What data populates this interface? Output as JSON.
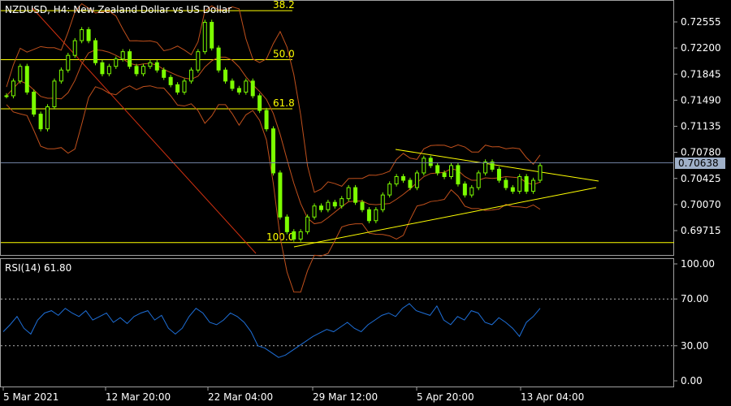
{
  "header": {
    "main_title": "NZDUSD, H4:  New Zealand Dollar vs US Dollar",
    "rsi_title": "RSI(14) 61.80"
  },
  "colors": {
    "background": "#000000",
    "candles": "#7cfc00",
    "bollinger": "#c0501c",
    "fib_lines": "#ffff00",
    "trendlines": "#ffff00",
    "rsi_line": "#1e6fd8",
    "current_price_line": "#6f7f9f",
    "current_price_box": "#9fb0c8"
  },
  "price_axis": {
    "ticks": [
      "0.72555",
      "0.72200",
      "0.71845",
      "0.71490",
      "0.71135",
      "0.70780",
      "0.70425",
      "0.70070",
      "0.69715"
    ],
    "current_price": "0.70638"
  },
  "fib_levels": [
    {
      "label": "38.2",
      "price": 0.72708
    },
    {
      "label": "50.0",
      "price": 0.72041
    },
    {
      "label": "61.8",
      "price": 0.71373
    },
    {
      "label": "100.0",
      "price": 0.69552
    }
  ],
  "rsi_axis": {
    "ticks": [
      "100.00",
      "70.00",
      "30.00",
      "0.00"
    ],
    "levels": [
      70,
      30
    ],
    "current": 61.8
  },
  "time_axis": {
    "labels": [
      "5 Mar 2021",
      "12 Mar 20:00",
      "22 Mar 04:00",
      "29 Mar 12:00",
      "5 Apr 20:00",
      "13 Apr 04:00"
    ]
  },
  "chart_data": {
    "type": "line",
    "title": "NZDUSD, H4:  New Zealand Dollar vs US Dollar",
    "series": [
      {
        "name": "NZDUSD",
        "values": [
          0.7155,
          0.7175,
          0.7195,
          0.716,
          0.713,
          0.711,
          0.714,
          0.7175,
          0.719,
          0.721,
          0.723,
          0.7245,
          0.723,
          0.72,
          0.7185,
          0.7195,
          0.7205,
          0.7215,
          0.7195,
          0.7185,
          0.7195,
          0.72,
          0.719,
          0.718,
          0.717,
          0.716,
          0.7175,
          0.719,
          0.7215,
          0.7255,
          0.722,
          0.719,
          0.7175,
          0.7165,
          0.716,
          0.7175,
          0.7155,
          0.7135,
          0.711,
          0.705,
          0.699,
          0.697,
          0.696,
          0.697,
          0.699,
          0.7005,
          0.7,
          0.701,
          0.7005,
          0.7015,
          0.703,
          0.701,
          0.7,
          0.6985,
          0.7,
          0.702,
          0.7035,
          0.7045,
          0.704,
          0.703,
          0.705,
          0.707,
          0.706,
          0.705,
          0.7045,
          0.706,
          0.7035,
          0.702,
          0.703,
          0.705,
          0.7065,
          0.7055,
          0.704,
          0.703,
          0.7025,
          0.7045,
          0.7025,
          0.704,
          0.706
        ]
      },
      {
        "name": "RSI(14)",
        "values": [
          42,
          48,
          55,
          45,
          40,
          52,
          58,
          60,
          56,
          62,
          58,
          55,
          60,
          52,
          55,
          58,
          50,
          54,
          49,
          55,
          58,
          60,
          52,
          56,
          45,
          40,
          45,
          55,
          62,
          58,
          50,
          48,
          52,
          58,
          55,
          50,
          42,
          30,
          28,
          24,
          20,
          22,
          26,
          30,
          34,
          38,
          41,
          44,
          42,
          46,
          50,
          45,
          42,
          48,
          52,
          56,
          58,
          55,
          62,
          66,
          60,
          58,
          56,
          64,
          52,
          48,
          55,
          52,
          60,
          58,
          50,
          48,
          54,
          50,
          45,
          38,
          50,
          55,
          62
        ]
      }
    ],
    "ylim_price": [
      0.695,
      0.7275
    ],
    "ylim_rsi": [
      0,
      100
    ]
  }
}
